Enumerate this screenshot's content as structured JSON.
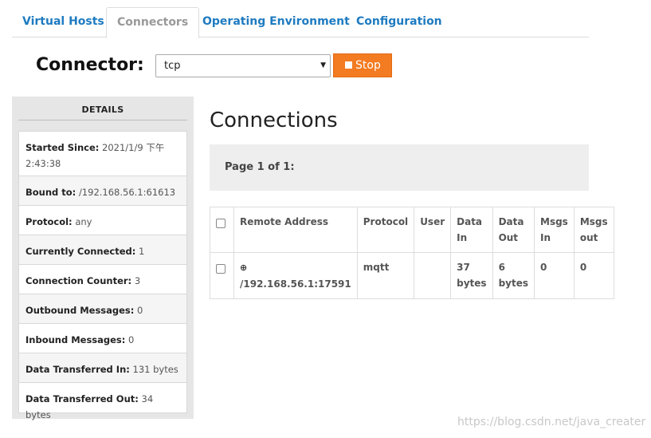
{
  "tabs": [
    {
      "label": "Virtual Hosts",
      "active": false
    },
    {
      "label": "Connectors",
      "active": true
    },
    {
      "label": "Operating Environment",
      "active": false
    },
    {
      "label": "Configuration",
      "active": false
    }
  ],
  "connector": {
    "label": "Connector:",
    "selected": "tcp",
    "stop_label": "Stop"
  },
  "details": {
    "heading": "DETAILS",
    "rows": [
      {
        "key": "Started Since:",
        "value": "2021/1/9 下午 2:43:38"
      },
      {
        "key": "Bound to:",
        "value": "/192.168.56.1:61613"
      },
      {
        "key": "Protocol:",
        "value": "any"
      },
      {
        "key": "Currently Connected:",
        "value": "1"
      },
      {
        "key": "Connection Counter:",
        "value": "3"
      },
      {
        "key": "Outbound Messages:",
        "value": "0"
      },
      {
        "key": "Inbound Messages:",
        "value": "0"
      },
      {
        "key": "Data Transferred In:",
        "value": "131 bytes"
      },
      {
        "key": "Data Transferred Out:",
        "value": "34 bytes"
      }
    ]
  },
  "connections": {
    "title": "Connections",
    "pager": "Page 1 of 1:",
    "columns": [
      "Remote Address",
      "Protocol",
      "User",
      "Data In",
      "Data Out",
      "Msgs In",
      "Msgs out"
    ],
    "rows": [
      {
        "remote_address": "/192.168.56.1:17591",
        "protocol": "mqtt",
        "user": "",
        "data_in": "37 bytes",
        "data_out": "6 bytes",
        "msgs_in": "0",
        "msgs_out": "0"
      }
    ]
  },
  "watermark": "https://blog.csdn.net/java_creater"
}
